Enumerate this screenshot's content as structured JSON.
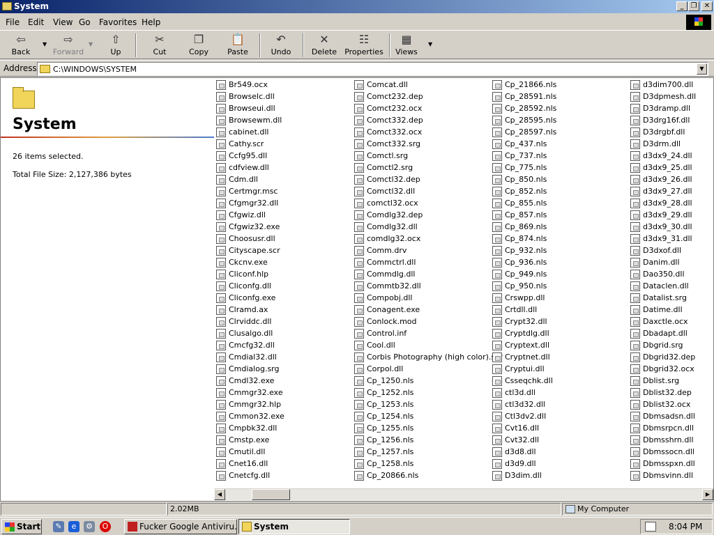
{
  "window": {
    "title": "System"
  },
  "menu": [
    "File",
    "Edit",
    "View",
    "Go",
    "Favorites",
    "Help"
  ],
  "toolbar": [
    {
      "label": "Back",
      "icon": "back-arrow-icon",
      "glyph": "⇦",
      "disabled": false
    },
    {
      "label": "Forward",
      "icon": "forward-arrow-icon",
      "glyph": "⇨",
      "disabled": true
    },
    {
      "label": "Up",
      "icon": "up-folder-icon",
      "glyph": "⇧",
      "disabled": false
    },
    {
      "label": "Cut",
      "icon": "scissors-icon",
      "glyph": "✂",
      "disabled": false
    },
    {
      "label": "Copy",
      "icon": "copy-icon",
      "glyph": "❐",
      "disabled": false
    },
    {
      "label": "Paste",
      "icon": "paste-icon",
      "glyph": "📋",
      "disabled": false
    },
    {
      "label": "Undo",
      "icon": "undo-icon",
      "glyph": "↶",
      "disabled": false
    },
    {
      "label": "Delete",
      "icon": "delete-x-icon",
      "glyph": "✕",
      "disabled": false
    },
    {
      "label": "Properties",
      "icon": "properties-icon",
      "glyph": "☷",
      "disabled": false
    },
    {
      "label": "Views",
      "icon": "views-icon",
      "glyph": "▦",
      "disabled": false
    }
  ],
  "address": {
    "label": "Address",
    "value": "C:\\WINDOWS\\SYSTEM"
  },
  "left_panel": {
    "title": "System",
    "selected": "26 items selected.",
    "size": "Total File Size: 2,127,386 bytes"
  },
  "columns": [
    [
      "Br549.ocx",
      "Browselc.dll",
      "Browseui.dll",
      "Browsewm.dll",
      "cabinet.dll",
      "Cathy.scr",
      "Ccfg95.dll",
      "cdfview.dll",
      "Cdm.dll",
      "Certmgr.msc",
      "Cfgmgr32.dll",
      "Cfgwiz.dll",
      "Cfgwiz32.exe",
      "Choosusr.dll",
      "Cityscape.scr",
      "Ckcnv.exe",
      "Cliconf.hlp",
      "Cliconfg.dll",
      "Cliconfg.exe",
      "Clramd.ax",
      "Clrviddc.dll",
      "Clusalgo.dll",
      "Cmcfg32.dll",
      "Cmdial32.dll",
      "Cmdialog.srg",
      "Cmdl32.exe",
      "Cmmgr32.exe",
      "Cmmgr32.hlp",
      "Cmmon32.exe",
      "Cmpbk32.dll",
      "Cmstp.exe",
      "Cmutil.dll",
      "Cnet16.dll",
      "Cnetcfg.dll"
    ],
    [
      "Comcat.dll",
      "Comct232.dep",
      "Comct232.ocx",
      "Comct332.dep",
      "Comct332.ocx",
      "Comct332.srg",
      "Comctl.srg",
      "Comctl2.srg",
      "Comctl32.dep",
      "Comctl32.dll",
      "comctl32.ocx",
      "Comdlg32.dep",
      "Comdlg32.dll",
      "comdlg32.ocx",
      "Comm.drv",
      "Commctrl.dll",
      "Commdlg.dll",
      "Commtb32.dll",
      "Compobj.dll",
      "Conagent.exe",
      "Conlock.mod",
      "Control.inf",
      "Cool.dll",
      "Corbis Photography (high color).scr",
      "Corpol.dll",
      "Cp_1250.nls",
      "Cp_1252.nls",
      "Cp_1253.nls",
      "Cp_1254.nls",
      "Cp_1255.nls",
      "Cp_1256.nls",
      "Cp_1257.nls",
      "Cp_1258.nls",
      "Cp_20866.nls"
    ],
    [
      "Cp_21866.nls",
      "Cp_28591.nls",
      "Cp_28592.nls",
      "Cp_28595.nls",
      "Cp_28597.nls",
      "Cp_437.nls",
      "Cp_737.nls",
      "Cp_775.nls",
      "Cp_850.nls",
      "Cp_852.nls",
      "Cp_855.nls",
      "Cp_857.nls",
      "Cp_869.nls",
      "Cp_874.nls",
      "Cp_932.nls",
      "Cp_936.nls",
      "Cp_949.nls",
      "Cp_950.nls",
      "Crswpp.dll",
      "Crtdll.dll",
      "Crypt32.dll",
      "Cryptdlg.dll",
      "Cryptext.dll",
      "Cryptnet.dll",
      "Cryptui.dll",
      "Csseqchk.dll",
      "ctl3d.dll",
      "ctl3d32.dll",
      "Ctl3dv2.dll",
      "Cvt16.dll",
      "Cvt32.dll",
      "d3d8.dll",
      "d3d9.dll",
      "D3dim.dll"
    ],
    [
      "d3dim700.dll",
      "D3dpmesh.dll",
      "D3dramp.dll",
      "D3drg16f.dll",
      "D3drgbf.dll",
      "D3drm.dll",
      "d3dx9_24.dll",
      "d3dx9_25.dll",
      "d3dx9_26.dll",
      "d3dx9_27.dll",
      "d3dx9_28.dll",
      "d3dx9_29.dll",
      "d3dx9_30.dll",
      "d3dx9_31.dll",
      "D3dxof.dll",
      "Danim.dll",
      "Dao350.dll",
      "Dataclen.dll",
      "Datalist.srg",
      "Datime.dll",
      "Daxctle.ocx",
      "Dbadapt.dll",
      "Dbgrid.srg",
      "Dbgrid32.dep",
      "Dbgrid32.ocx",
      "Dblist.srg",
      "Dblist32.dep",
      "Dblist32.ocx",
      "Dbmsadsn.dll",
      "Dbmsrpcn.dll",
      "Dbmsshrn.dll",
      "Dbmssocn.dll",
      "Dbmsspxn.dll",
      "Dbmsvinn.dll"
    ]
  ],
  "status": {
    "size": "2.02MB",
    "zone": "My Computer"
  },
  "taskbar": {
    "start": "Start",
    "tasks": [
      "Fucker Google Antiviru...",
      "System"
    ],
    "clock": "8:04 PM"
  }
}
